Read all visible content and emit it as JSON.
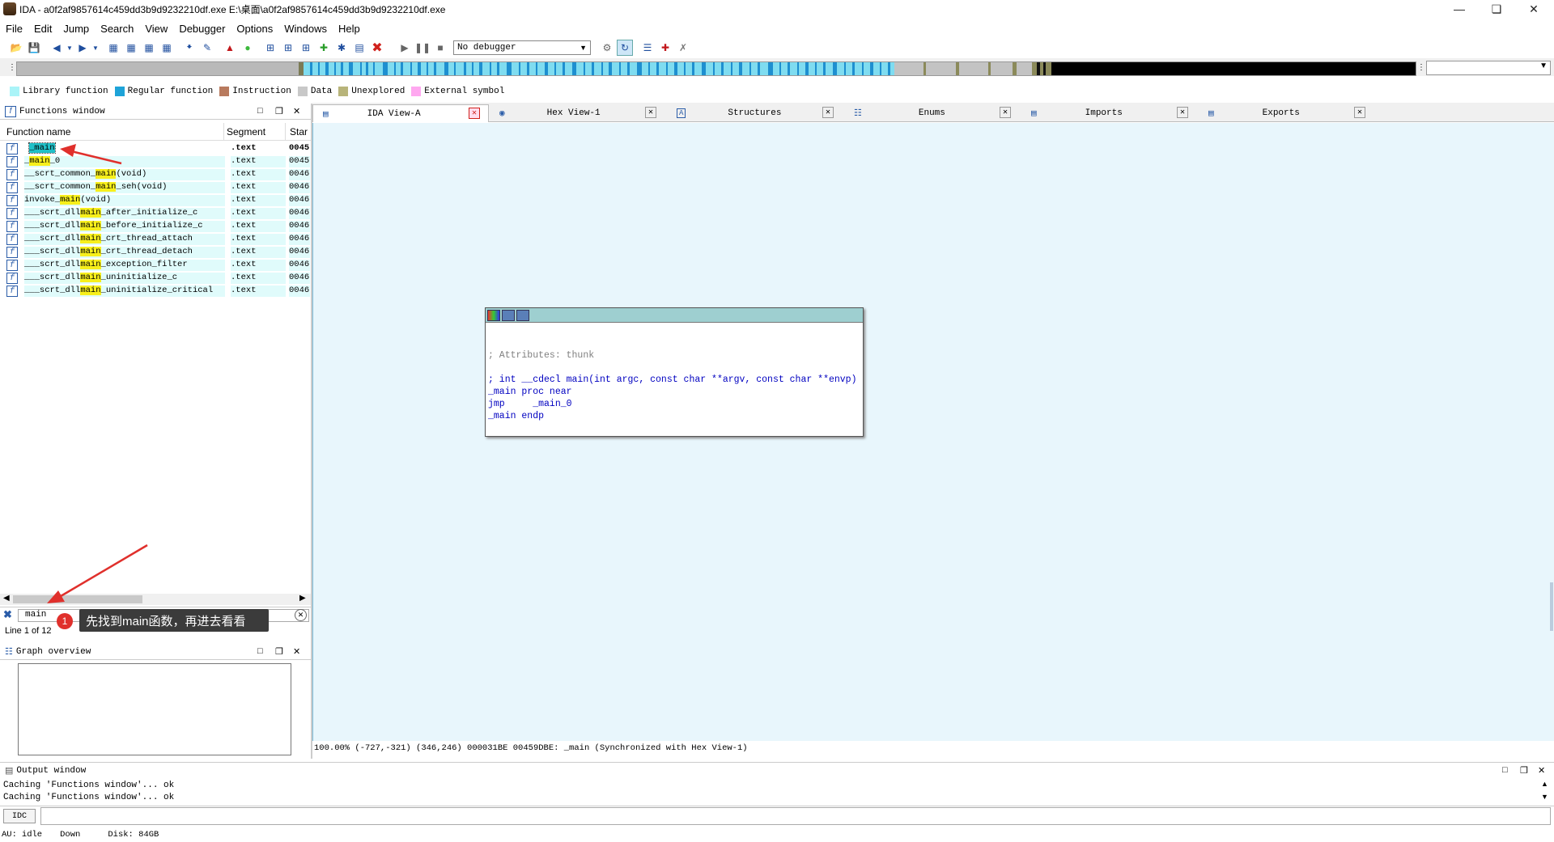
{
  "window": {
    "title": "IDA - a0f2af9857614c459dd3b9d9232210df.exe E:\\桌面\\a0f2af9857614c459dd3b9d9232210df.exe"
  },
  "menu": [
    "File",
    "Edit",
    "Jump",
    "Search",
    "View",
    "Debugger",
    "Options",
    "Windows",
    "Help"
  ],
  "toolbar": {
    "debugger_select": "No debugger"
  },
  "legend": [
    {
      "label": "Library function",
      "color": "#aaf4f8"
    },
    {
      "label": "Regular function",
      "color": "#1ea3d8"
    },
    {
      "label": "Instruction",
      "color": "#b87a5e"
    },
    {
      "label": "Data",
      "color": "#c8c8c8"
    },
    {
      "label": "Unexplored",
      "color": "#b8b47a"
    },
    {
      "label": "External symbol",
      "color": "#ffa8f0"
    }
  ],
  "functions_window": {
    "title": "Functions window",
    "columns": [
      "Function name",
      "Segment",
      "Star"
    ],
    "rows": [
      {
        "pre": "",
        "hl": "_main",
        "post": "",
        "seg": ".text",
        "addr": "0045",
        "selected": true
      },
      {
        "pre": "_",
        "hl": "main",
        "post": "_0",
        "seg": ".text",
        "addr": "0045"
      },
      {
        "pre": "__scrt_common_",
        "hl": "main",
        "post": "(void)",
        "seg": ".text",
        "addr": "0046"
      },
      {
        "pre": "__scrt_common_",
        "hl": "main",
        "post": "_seh(void)",
        "seg": ".text",
        "addr": "0046"
      },
      {
        "pre": "invoke_",
        "hl": "main",
        "post": "(void)",
        "seg": ".text",
        "addr": "0046"
      },
      {
        "pre": "___scrt_dll",
        "hl": "main",
        "post": "_after_initialize_c",
        "seg": ".text",
        "addr": "0046"
      },
      {
        "pre": "___scrt_dll",
        "hl": "main",
        "post": "_before_initialize_c",
        "seg": ".text",
        "addr": "0046"
      },
      {
        "pre": "___scrt_dll",
        "hl": "main",
        "post": "_crt_thread_attach",
        "seg": ".text",
        "addr": "0046"
      },
      {
        "pre": "___scrt_dll",
        "hl": "main",
        "post": "_crt_thread_detach",
        "seg": ".text",
        "addr": "0046"
      },
      {
        "pre": "___scrt_dll",
        "hl": "main",
        "post": "_exception_filter",
        "seg": ".text",
        "addr": "0046"
      },
      {
        "pre": "___scrt_dll",
        "hl": "main",
        "post": "_uninitialize_c",
        "seg": ".text",
        "addr": "0046"
      },
      {
        "pre": "___scrt_dll",
        "hl": "main",
        "post": "_uninitialize_critical",
        "seg": ".text",
        "addr": "0046"
      }
    ],
    "filter_value": "main",
    "line_info": "Line 1 of 12"
  },
  "annotation": {
    "number": "1",
    "text": "先找到main函数，再进去看看"
  },
  "graph_overview": {
    "title": "Graph overview"
  },
  "tabs": [
    "IDA View-A",
    "Hex View-1",
    "Structures",
    "Enums",
    "Imports",
    "Exports"
  ],
  "code": {
    "lines": [
      "; Attributes: thunk",
      "",
      "; int __cdecl main(int argc, const char **argv, const char **envp)",
      "_main proc near",
      "jmp     _main_0",
      "_main endp"
    ]
  },
  "view_status": "100.00% (-727,-321) (346,246) 000031BE 00459DBE: _main (Synchronized with Hex View-1)",
  "output": {
    "title": "Output window",
    "lines": [
      "Caching 'Functions window'... ok",
      "Caching 'Functions window'... ok"
    ],
    "idc_label": "IDC"
  },
  "statusbar": {
    "au": "AU:",
    "state": "idle",
    "dir": "Down",
    "disk": "Disk: 84GB"
  }
}
